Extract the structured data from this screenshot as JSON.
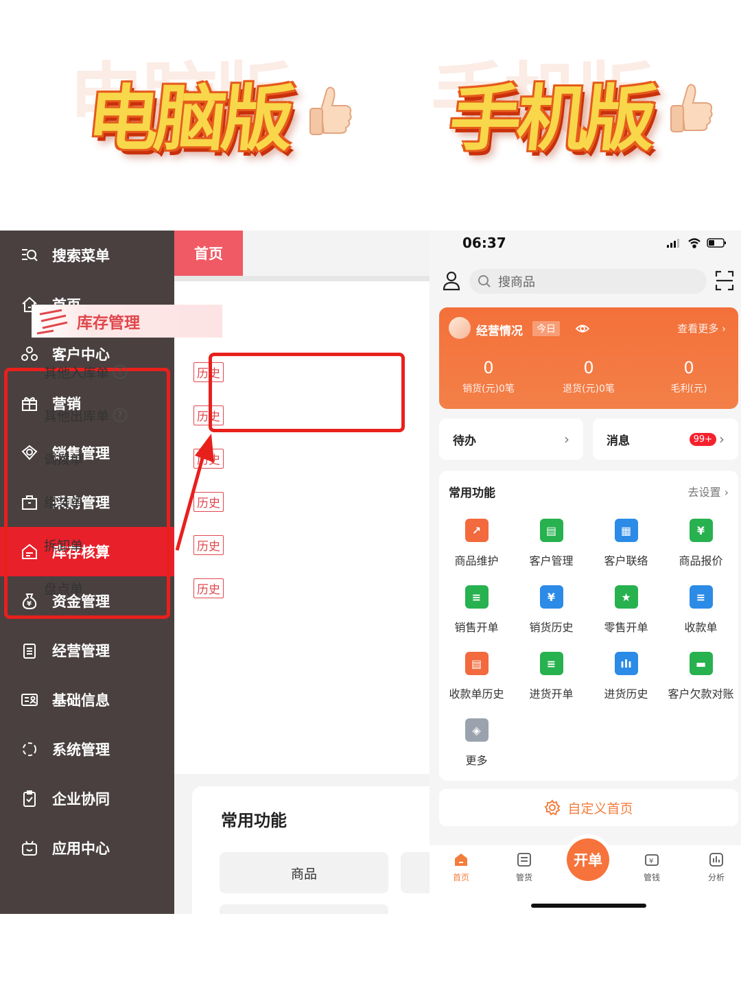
{
  "banner": {
    "left_text": "电脑版",
    "right_text": "手机版"
  },
  "desktop": {
    "sidebar": [
      {
        "label": "搜索菜单",
        "icon": "search-menu-icon"
      },
      {
        "label": "首页",
        "icon": "home-icon"
      },
      {
        "label": "客户中心",
        "icon": "customer-icon"
      },
      {
        "label": "营销",
        "icon": "gift-icon"
      },
      {
        "label": "销售管理",
        "icon": "sales-icon"
      },
      {
        "label": "采购管理",
        "icon": "purchase-icon"
      },
      {
        "label": "库存核算",
        "icon": "inventory-icon",
        "active": true
      },
      {
        "label": "资金管理",
        "icon": "money-bag-icon"
      },
      {
        "label": "经营管理",
        "icon": "clipboard-icon"
      },
      {
        "label": "基础信息",
        "icon": "id-card-icon"
      },
      {
        "label": "系统管理",
        "icon": "system-icon"
      },
      {
        "label": "企业协同",
        "icon": "collab-icon"
      },
      {
        "label": "应用中心",
        "icon": "app-center-icon"
      }
    ],
    "tab_home": "首页",
    "menu_title": "库存管理",
    "menu_rows": [
      {
        "label": "其他入库单",
        "help": true,
        "history": "历史"
      },
      {
        "label": "其他出库单",
        "help": true,
        "history": "历史"
      },
      {
        "label": "调拨单",
        "help": false,
        "history": "历史"
      },
      {
        "label": "组装单",
        "help": false,
        "history": "历史"
      },
      {
        "label": "拆卸单",
        "help": false,
        "history": "历史"
      },
      {
        "label": "盘点单",
        "help": false,
        "history": "历史"
      }
    ],
    "help_glyph": "?",
    "common_title": "常用功能",
    "common_button": "商品"
  },
  "mobile": {
    "status_time": "06:37",
    "search_placeholder": "搜商品",
    "biz": {
      "title": "经营情况",
      "today": "今日",
      "more": "查看更多",
      "stats": [
        {
          "value": "0",
          "label": "销货(元)0笔"
        },
        {
          "value": "0",
          "label": "退货(元)0笔"
        },
        {
          "value": "0",
          "label": "毛利(元)"
        }
      ]
    },
    "todo": "待办",
    "message": "消息",
    "message_badge": "99+",
    "functions_title": "常用功能",
    "functions_setting": "去设置",
    "functions": [
      {
        "label": "商品维护",
        "color": "#f26a3d",
        "glyph": "↗"
      },
      {
        "label": "客户管理",
        "color": "#27b14f",
        "glyph": "▤"
      },
      {
        "label": "客户联络",
        "color": "#2b8be6",
        "glyph": "▦"
      },
      {
        "label": "商品报价",
        "color": "#27b14f",
        "glyph": "¥"
      },
      {
        "label": "销售开单",
        "color": "#27b14f",
        "glyph": "≡"
      },
      {
        "label": "销货历史",
        "color": "#2b8be6",
        "glyph": "¥"
      },
      {
        "label": "零售开单",
        "color": "#27b14f",
        "glyph": "★"
      },
      {
        "label": "收款单",
        "color": "#2b8be6",
        "glyph": "≡"
      },
      {
        "label": "收款单历史",
        "color": "#f26a3d",
        "glyph": "▤"
      },
      {
        "label": "进货开单",
        "color": "#27b14f",
        "glyph": "≡"
      },
      {
        "label": "进货历史",
        "color": "#2b8be6",
        "glyph": "ılı"
      },
      {
        "label": "客户欠款对账",
        "color": "#27b14f",
        "glyph": "▬"
      },
      {
        "label": "更多",
        "color": "#9aa3ad",
        "glyph": "◈"
      }
    ],
    "custom_home": "自定义首页",
    "tabs": [
      {
        "label": "首页",
        "icon": "home-tab-icon",
        "active": true
      },
      {
        "label": "管货",
        "icon": "goods-tab-icon"
      },
      {
        "label": "开单",
        "icon": "create-order-icon"
      },
      {
        "label": "管钱",
        "icon": "money-tab-icon"
      },
      {
        "label": "分析",
        "icon": "analysis-tab-icon"
      }
    ]
  },
  "colors": {
    "sidebar_bg": "#4a4040",
    "sidebar_active": "#e8202a",
    "highlight_red": "#e8201c",
    "mobile_accent": "#f37d3d"
  }
}
